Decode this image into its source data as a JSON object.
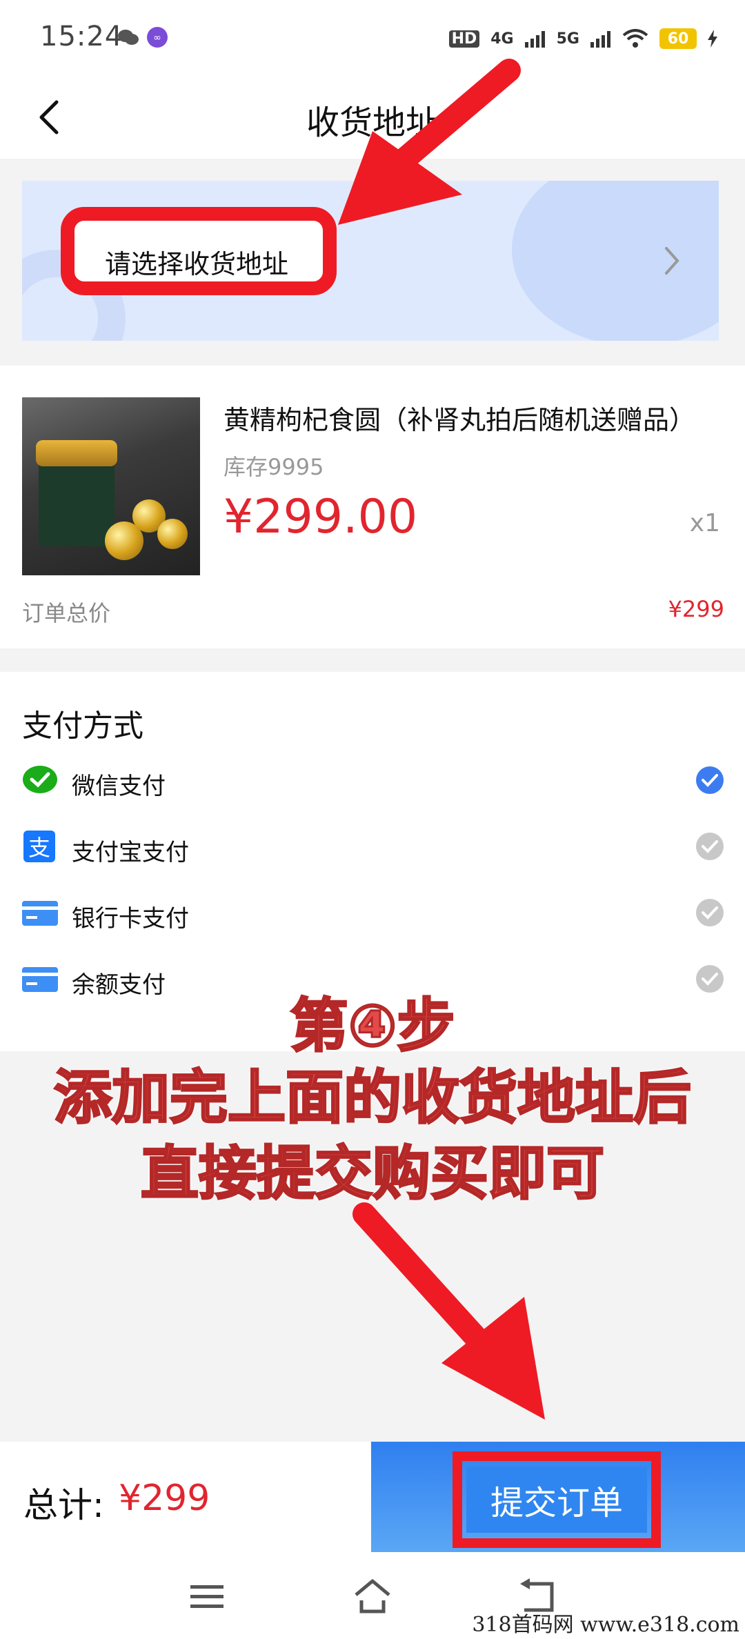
{
  "status_bar": {
    "time": "15:24",
    "hd": "HD",
    "net1": "4G",
    "net2": "5G",
    "battery": "60"
  },
  "header": {
    "title": "收货地址"
  },
  "address": {
    "prompt": "请选择收货地址"
  },
  "product": {
    "name": "黄精枸杞食圆（补肾丸拍后随机送赠品）",
    "stock": "库存9995",
    "price": "¥299.00",
    "quantity": "x1",
    "order_total_label": "订单总价",
    "order_total_value": "¥299"
  },
  "payment": {
    "title": "支付方式",
    "methods": [
      {
        "label": "微信支付",
        "icon": "wechat-pay-icon",
        "selected": true
      },
      {
        "label": "支付宝支付",
        "icon": "alipay-icon",
        "selected": false
      },
      {
        "label": "银行卡支付",
        "icon": "bank-card-icon",
        "selected": false
      },
      {
        "label": "余额支付",
        "icon": "balance-icon",
        "selected": false
      }
    ]
  },
  "overlay": {
    "line1": "第④步",
    "line2": "添加完上面的收货地址后",
    "line3": "直接提交购买即可"
  },
  "footer": {
    "total_label": "总计:",
    "total_value": "¥299",
    "submit_label": "提交订单"
  },
  "watermark": "318首码网   www.e318.com",
  "colors": {
    "accent": "#2f86f0",
    "price": "#e1252f",
    "highlight": "#ee1b24",
    "check_selected": "#3d7cf0",
    "check_unselected": "#c8c8c8"
  }
}
